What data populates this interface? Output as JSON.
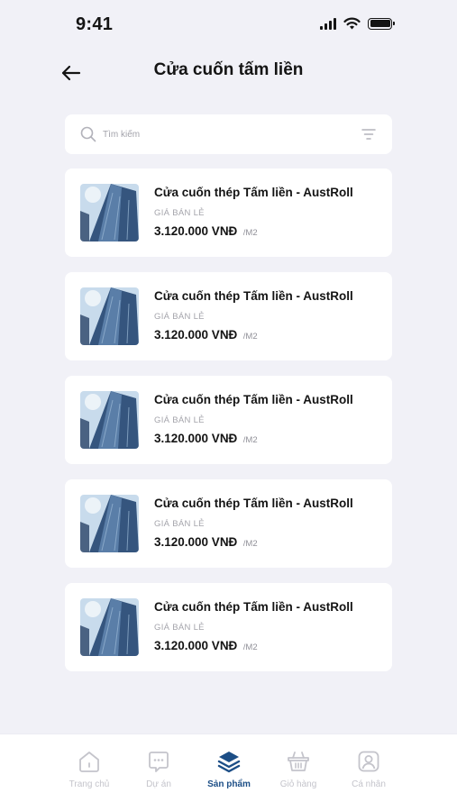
{
  "status_bar": {
    "time": "9:41"
  },
  "header": {
    "title": "Cửa cuốn tấm liền"
  },
  "search": {
    "placeholder": "Tìm kiếm"
  },
  "products": [
    {
      "name": "Cửa cuốn thép Tấm liền - AustRoll",
      "price_label": "GIÁ BÁN LẺ",
      "price": "3.120.000 VNĐ",
      "unit": "/M2"
    },
    {
      "name": "Cửa cuốn thép Tấm liền - AustRoll",
      "price_label": "GIÁ BÁN LẺ",
      "price": "3.120.000 VNĐ",
      "unit": "/M2"
    },
    {
      "name": "Cửa cuốn thép Tấm liền - AustRoll",
      "price_label": "GIÁ BÁN LẺ",
      "price": "3.120.000 VNĐ",
      "unit": "/M2"
    },
    {
      "name": "Cửa cuốn thép Tấm liền - AustRoll",
      "price_label": "GIÁ BÁN LẺ",
      "price": "3.120.000 VNĐ",
      "unit": "/M2"
    },
    {
      "name": "Cửa cuốn thép Tấm liền - AustRoll",
      "price_label": "GIÁ BÁN LẺ",
      "price": "3.120.000 VNĐ",
      "unit": "/M2"
    }
  ],
  "tab_bar": {
    "items": [
      {
        "label": "Trang chủ",
        "icon": "home-icon"
      },
      {
        "label": "Dự án",
        "icon": "chat-icon"
      },
      {
        "label": "Sản phẩm",
        "icon": "layers-icon",
        "active": true
      },
      {
        "label": "Giỏ hàng",
        "icon": "basket-icon"
      },
      {
        "label": "Cá nhân",
        "icon": "profile-icon"
      }
    ]
  },
  "colors": {
    "background": "#f1f1f7",
    "card": "#ffffff",
    "accent": "#1c4e86",
    "inactive": "#c4c4cb",
    "muted_text": "#a4a4ab"
  }
}
